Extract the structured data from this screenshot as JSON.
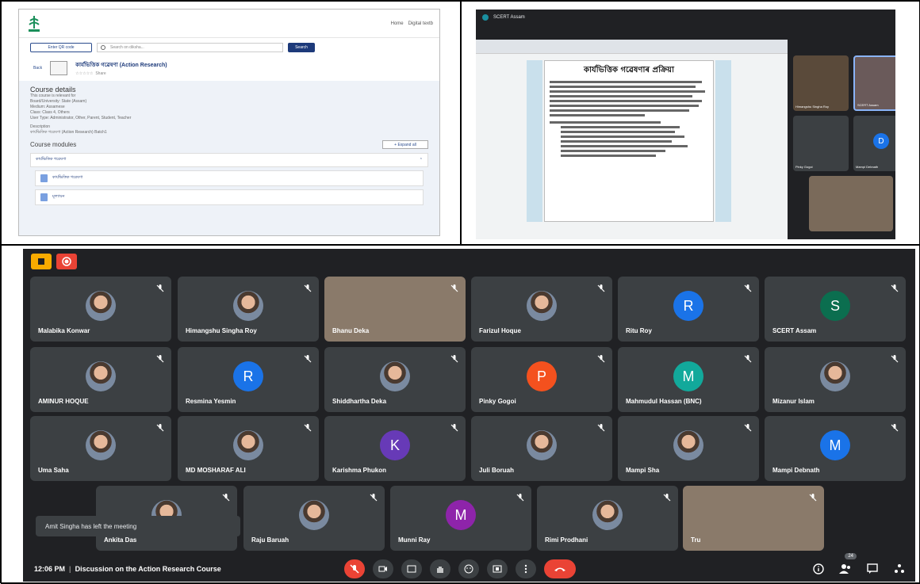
{
  "course_page": {
    "nav": [
      "Home",
      "Digital textb"
    ],
    "qr_label": "Enter QR code",
    "search_placeholder": "Search on diksha...",
    "search_button": "Search",
    "back_label": "Back",
    "course_title": "কাৰ্যভিত্তিক গৱেষণা (Action Research)",
    "share_label": "Share",
    "details_heading": "Course details",
    "relevant_for": "This course is relevant for",
    "board": "Board/University: State (Assam)",
    "medium": "Medium: Assamese",
    "class": "Class: Class 4, Others",
    "user_type": "User Type: Administrator, Other, Parent, Student, Teacher",
    "description_label": "Description",
    "description": "কাৰ্যভিত্তিক গৱেষণা (Action Research) Batch1",
    "modules_heading": "Course modules",
    "expand_all": "+ Expand all",
    "accordion_title": "কাৰ্যভিত্তিক গৱেষণা",
    "modules": [
      "কাৰ্যভিত্তিক গৱেষণা",
      "মূল্যায়ন"
    ]
  },
  "meet_top": {
    "header": "SCERT Assam",
    "doc_title": "কাৰ্যভিত্তিক গৱেষণাৰ প্ৰক্ৰিয়া",
    "participants": [
      {
        "name": "Himangshu Singha Roy"
      },
      {
        "name": "SCERT Assam"
      },
      {
        "name": "Pinky Gogoi"
      },
      {
        "name": "Mampi Debnath",
        "initial": "D"
      }
    ]
  },
  "meet_bottom": {
    "tiles": [
      {
        "name": "Malabika Konwar",
        "type": "photo"
      },
      {
        "name": "Himangshu Singha Roy",
        "type": "photo"
      },
      {
        "name": "Bhanu Deka",
        "type": "video"
      },
      {
        "name": "Farizul Hoque",
        "type": "photo"
      },
      {
        "name": "Ritu Roy",
        "type": "initial",
        "initial": "R",
        "color": "#1a73e8"
      },
      {
        "name": "SCERT Assam",
        "type": "initial",
        "initial": "S",
        "color": "#0b6e4f"
      },
      {
        "name": "AMINUR HOQUE",
        "type": "photo"
      },
      {
        "name": "Resmina Yesmin",
        "type": "initial",
        "initial": "R",
        "color": "#1a73e8"
      },
      {
        "name": "Shiddhartha Deka",
        "type": "photo"
      },
      {
        "name": "Pinky Gogoi",
        "type": "initial",
        "initial": "P",
        "color": "#f4511e"
      },
      {
        "name": "Mahmudul Hassan (BNC)",
        "type": "initial",
        "initial": "M",
        "color": "#12a99b"
      },
      {
        "name": "Mizanur Islam",
        "type": "photo"
      },
      {
        "name": "Uma Saha",
        "type": "photo"
      },
      {
        "name": "MD MOSHARAF ALI",
        "type": "photo"
      },
      {
        "name": "Karishma Phukon",
        "type": "initial",
        "initial": "K",
        "color": "#673ab7"
      },
      {
        "name": "Juli Boruah",
        "type": "photo"
      },
      {
        "name": "Mampi Sha",
        "type": "photo"
      },
      {
        "name": "Mampi Debnath",
        "type": "initial",
        "initial": "M",
        "color": "#1a73e8"
      },
      {
        "name": "Ankita Das",
        "type": "photo"
      },
      {
        "name": "Raju Baruah",
        "type": "photo"
      },
      {
        "name": "Munni Ray",
        "type": "initial",
        "initial": "M",
        "color": "#8e24aa"
      },
      {
        "name": "Rimi Prodhani",
        "type": "photo"
      },
      {
        "name": "Tru",
        "type": "video"
      }
    ],
    "toast": "Amit Singha has left the meeting",
    "time": "12:06 PM",
    "meeting_title": "Discussion on the Action Research Course",
    "participant_count": "24"
  }
}
